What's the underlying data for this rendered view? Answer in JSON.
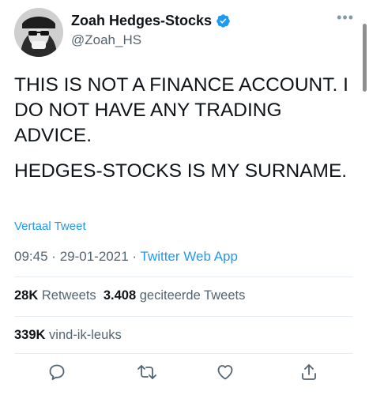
{
  "tweet": {
    "author": {
      "display_name": "Zoah Hedges-Stocks",
      "handle": "@Zoah_HS",
      "verified": true
    },
    "text_paragraphs": [
      "THIS IS NOT A FINANCE ACCOUNT. I DO NOT HAVE ANY TRADING ADVICE.",
      "HEDGES-STOCKS IS MY SURNAME."
    ],
    "translate_label": "Vertaal Tweet",
    "time": "09:45",
    "date": "29-01-2021",
    "separator": "·",
    "source": "Twitter Web App",
    "stats": {
      "retweets_count": "28K",
      "retweets_label": "Retweets",
      "quotes_count": "3.408",
      "quotes_label": "geciteerde Tweets",
      "likes_count": "339K",
      "likes_label": "vind-ik-leuks"
    },
    "actions": [
      "reply-icon",
      "retweet-icon",
      "like-icon",
      "share-icon"
    ]
  },
  "colors": {
    "accent": "#1d9bf0",
    "secondary_text": "#536471",
    "divider": "#e6ecf0"
  }
}
